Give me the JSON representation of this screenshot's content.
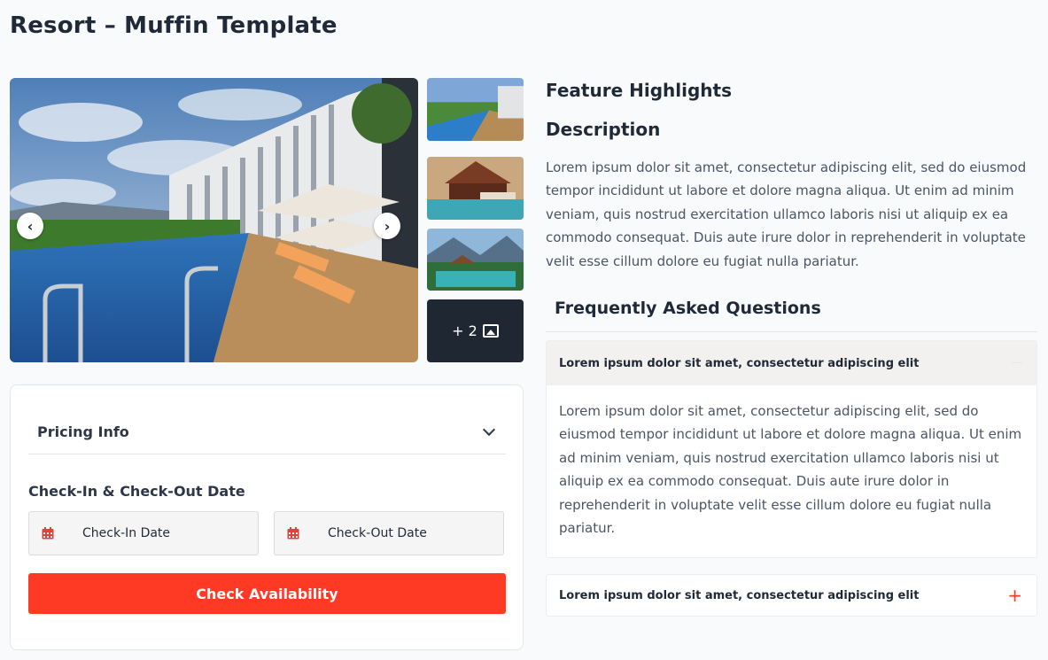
{
  "page": {
    "title": "Resort – Muffin Template"
  },
  "gallery": {
    "prev_icon": "chevron-left-icon",
    "next_icon": "chevron-right-icon",
    "more_count": "+ 2",
    "more_icon": "image-icon"
  },
  "booking": {
    "pricing_label": "Pricing Info",
    "dates_heading": "Check-In & Check-Out Date",
    "checkin_placeholder": "Check-In Date",
    "checkout_placeholder": "Check-Out Date",
    "check_button": "Check Availability"
  },
  "details": {
    "feature_title": "Feature Highlights",
    "description_title": "Description",
    "description_text": "Lorem ipsum dolor sit amet, consectetur adipiscing elit, sed do eiusmod tempor incididunt ut labore et dolore magna aliqua. Ut enim ad minim veniam, quis nostrud exercitation ullamco laboris nisi ut aliquip ex ea commodo consequat. Duis aute irure dolor in reprehenderit in voluptate velit esse cillum dolore eu fugiat nulla pariatur."
  },
  "faq": {
    "title": "Frequently Asked Questions",
    "items": [
      {
        "question": "Lorem ipsum dolor sit amet, consectetur adipiscing elit",
        "answer": "Lorem ipsum dolor sit amet, consectetur adipiscing elit, sed do eiusmod tempor incididunt ut labore et dolore magna aliqua. Ut enim ad minim veniam, quis nostrud exercitation ullamco laboris nisi ut aliquip ex ea commodo consequat. Duis aute irure dolor in reprehenderit in voluptate velit esse cillum dolore eu fugiat nulla pariatur."
      },
      {
        "question": "Lorem ipsum dolor sit amet, consectetur adipiscing elit",
        "toggle": "+"
      }
    ]
  },
  "colors": {
    "accent": "#ff3a24",
    "text": "#1f2937",
    "muted": "#4b5563"
  }
}
